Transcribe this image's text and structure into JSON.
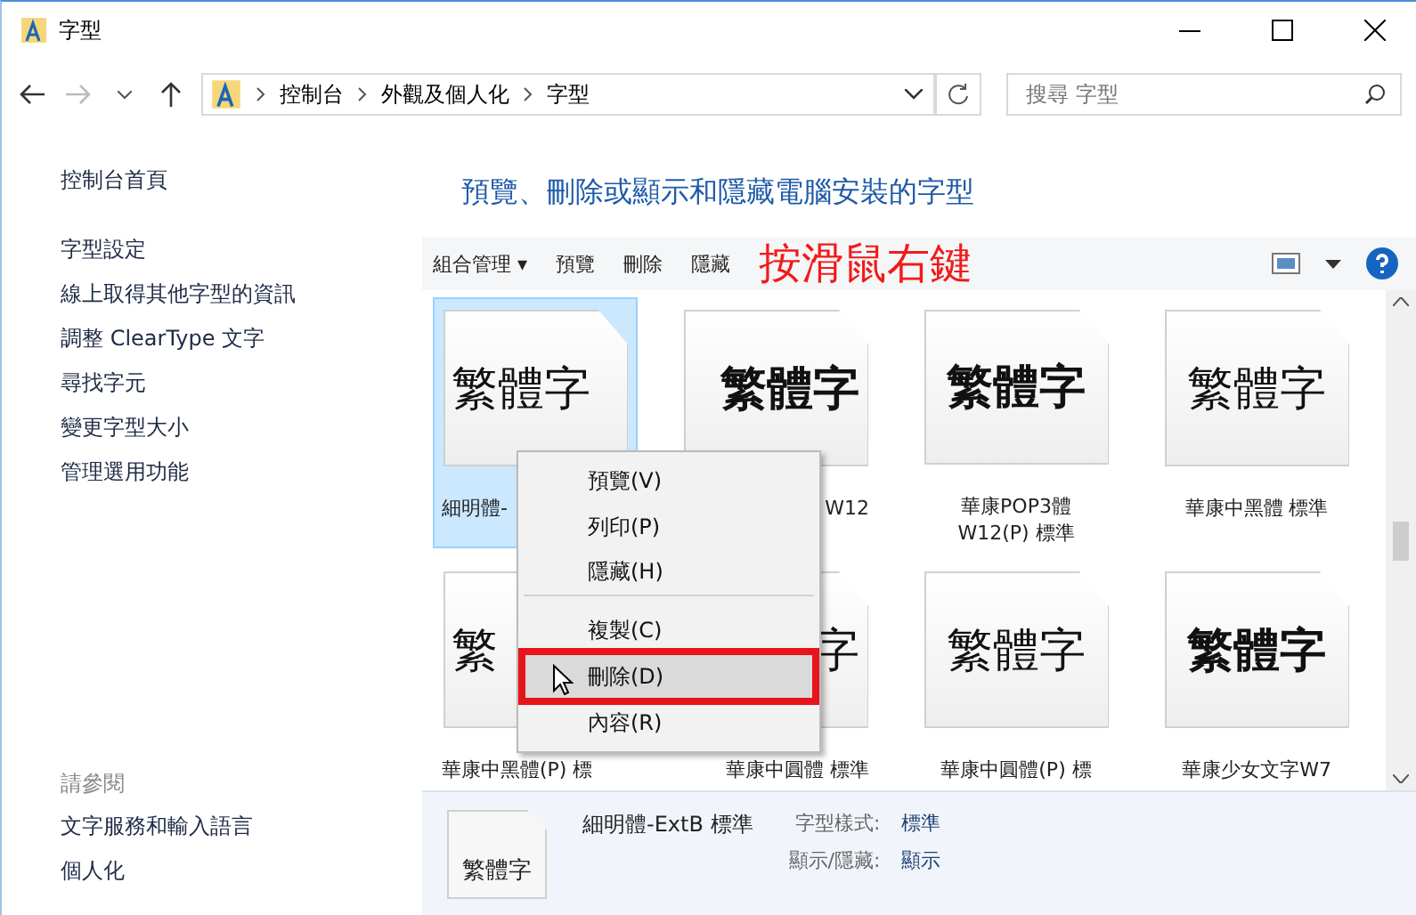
{
  "window": {
    "title": "字型"
  },
  "address": {
    "crumbs": [
      "控制台",
      "外觀及個人化",
      "字型"
    ],
    "search_placeholder": "搜尋 字型"
  },
  "sidebar": {
    "home": "控制台首頁",
    "items": [
      "字型設定",
      "線上取得其他字型的資訊",
      "調整 ClearType 文字",
      "尋找字元",
      "變更字型大小",
      "管理選用功能"
    ],
    "see_also": {
      "heading": "請參閱",
      "items": [
        "文字服務和輸入語言",
        "個人化"
      ]
    }
  },
  "heading": "預覽、刪除或顯示和隱藏電腦安裝的字型",
  "toolbar": {
    "items": [
      "組合管理 ▾",
      "預覽",
      "刪除",
      "隱藏"
    ],
    "annotation": "按滑鼠右鍵"
  },
  "fonts": [
    {
      "sample": "繁體字",
      "label": "細明體-",
      "bold": false,
      "selected": true,
      "kind": "left"
    },
    {
      "sample": "繁體字",
      "label": "W12",
      "bold": true,
      "selected": false,
      "kind": "right"
    },
    {
      "sample": "繁體字",
      "label": "華康POP3體 W12(P) 標準",
      "bold": true,
      "selected": false,
      "kind": "center"
    },
    {
      "sample": "繁體字",
      "label": "華康中黑體 標準",
      "bold": false,
      "selected": false,
      "kind": "center"
    },
    {
      "sample": "繁",
      "label": "華康中黑體(P) 標",
      "bold": false,
      "selected": false,
      "kind": "left"
    },
    {
      "sample": "字",
      "label": "華康中圓體 標準",
      "bold": false,
      "selected": false,
      "kind": "right"
    },
    {
      "sample": "繁體字",
      "label": "華康中圓體(P) 標",
      "bold": false,
      "selected": false,
      "kind": "center"
    },
    {
      "sample": "繁體字",
      "label": "華康少女文字W7",
      "bold": true,
      "selected": false,
      "kind": "center"
    }
  ],
  "context_menu": [
    {
      "label": "預覽(V)",
      "separator_after": false,
      "highlighted": false
    },
    {
      "label": "列印(P)",
      "separator_after": false,
      "highlighted": false
    },
    {
      "label": "隱藏(H)",
      "separator_after": true,
      "highlighted": false
    },
    {
      "label": "複製(C)",
      "separator_after": false,
      "highlighted": false
    },
    {
      "label": "刪除(D)",
      "separator_after": false,
      "highlighted": true
    },
    {
      "label": "內容(R)",
      "separator_after": false,
      "highlighted": false
    }
  ],
  "details": {
    "sample": "繁體字",
    "name": "細明體-ExtB 標準",
    "fields": [
      {
        "label": "字型樣式:",
        "value": "標準"
      },
      {
        "label": "顯示/隱藏:",
        "value": "顯示"
      }
    ]
  }
}
